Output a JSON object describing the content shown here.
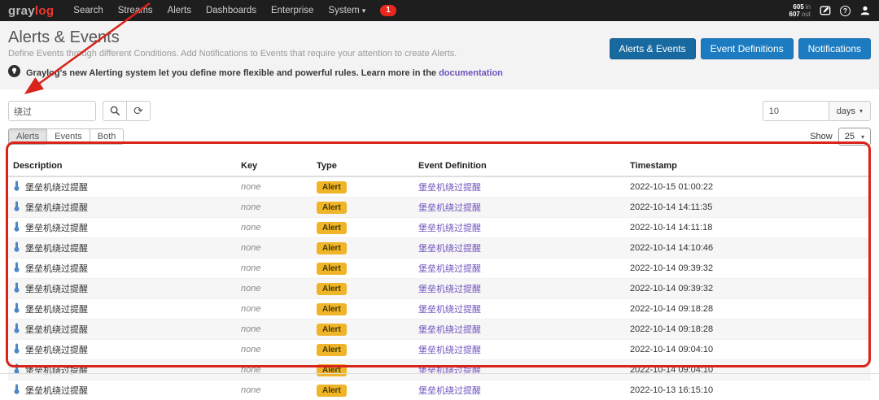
{
  "colors": {
    "navbar_bg": "#1e1e1e",
    "logo_red": "#f0372e",
    "accent_blue": "#1d7cc1",
    "accent_blue_active": "#17699f",
    "link_purple": "#6e54bc",
    "alert_badge_yellow": "#f0b429",
    "notification_badge_red": "#e8281c",
    "annotation_red": "#d8241a",
    "row_stripe": "#f6f6f6"
  },
  "icons": {
    "caret_down": "▾",
    "refresh": "⟳",
    "help": "?"
  },
  "navbar": {
    "logo_gray": "gray",
    "logo_red_text": "log",
    "items": [
      {
        "label": "Search"
      },
      {
        "label": "Streams"
      },
      {
        "label": "Alerts"
      },
      {
        "label": "Dashboards"
      },
      {
        "label": "Enterprise"
      },
      {
        "label": "System",
        "caret": true
      }
    ],
    "notification_count": "1",
    "throughput": {
      "in_value": "605",
      "in_unit": "in",
      "out_value": "607",
      "out_unit": "out"
    }
  },
  "header": {
    "title": "Alerts & Events",
    "subtitle": "Define Events through different Conditions. Add Notifications to Events that require your attention to create Alerts.",
    "info_text": "Graylog's new Alerting system let you define more flexible and powerful rules. Learn more in the",
    "info_link": "documentation",
    "buttons": [
      "Alerts & Events",
      "Event Definitions",
      "Notifications"
    ],
    "active_button": "Alerts & Events"
  },
  "toolbar": {
    "search_value": "绕过",
    "range_value": "10",
    "range_unit": "days",
    "tabs": [
      "Alerts",
      "Events",
      "Both"
    ],
    "active_tab": "Alerts",
    "show_label": "Show",
    "page_size": "25"
  },
  "table": {
    "columns": [
      "Description",
      "Key",
      "Type",
      "Event Definition",
      "Timestamp"
    ],
    "rows": [
      {
        "description": "堡垒机绕过提醒",
        "key": "none",
        "type": "Alert",
        "event_definition": "堡垒机绕过提醒",
        "timestamp": "2022-10-15 01:00:22"
      },
      {
        "description": "堡垒机绕过提醒",
        "key": "none",
        "type": "Alert",
        "event_definition": "堡垒机绕过提醒",
        "timestamp": "2022-10-14 14:11:35"
      },
      {
        "description": "堡垒机绕过提醒",
        "key": "none",
        "type": "Alert",
        "event_definition": "堡垒机绕过提醒",
        "timestamp": "2022-10-14 14:11:18"
      },
      {
        "description": "堡垒机绕过提醒",
        "key": "none",
        "type": "Alert",
        "event_definition": "堡垒机绕过提醒",
        "timestamp": "2022-10-14 14:10:46"
      },
      {
        "description": "堡垒机绕过提醒",
        "key": "none",
        "type": "Alert",
        "event_definition": "堡垒机绕过提醒",
        "timestamp": "2022-10-14 09:39:32"
      },
      {
        "description": "堡垒机绕过提醒",
        "key": "none",
        "type": "Alert",
        "event_definition": "堡垒机绕过提醒",
        "timestamp": "2022-10-14 09:39:32"
      },
      {
        "description": "堡垒机绕过提醒",
        "key": "none",
        "type": "Alert",
        "event_definition": "堡垒机绕过提醒",
        "timestamp": "2022-10-14 09:18:28"
      },
      {
        "description": "堡垒机绕过提醒",
        "key": "none",
        "type": "Alert",
        "event_definition": "堡垒机绕过提醒",
        "timestamp": "2022-10-14 09:18:28"
      },
      {
        "description": "堡垒机绕过提醒",
        "key": "none",
        "type": "Alert",
        "event_definition": "堡垒机绕过提醒",
        "timestamp": "2022-10-14 09:04:10"
      },
      {
        "description": "堡垒机绕过提醒",
        "key": "none",
        "type": "Alert",
        "event_definition": "堡垒机绕过提醒",
        "timestamp": "2022-10-14 09:04:10"
      },
      {
        "description": "堡垒机绕过提醒",
        "key": "none",
        "type": "Alert",
        "event_definition": "堡垒机绕过提醒",
        "timestamp": "2022-10-13 16:15:10"
      }
    ]
  }
}
